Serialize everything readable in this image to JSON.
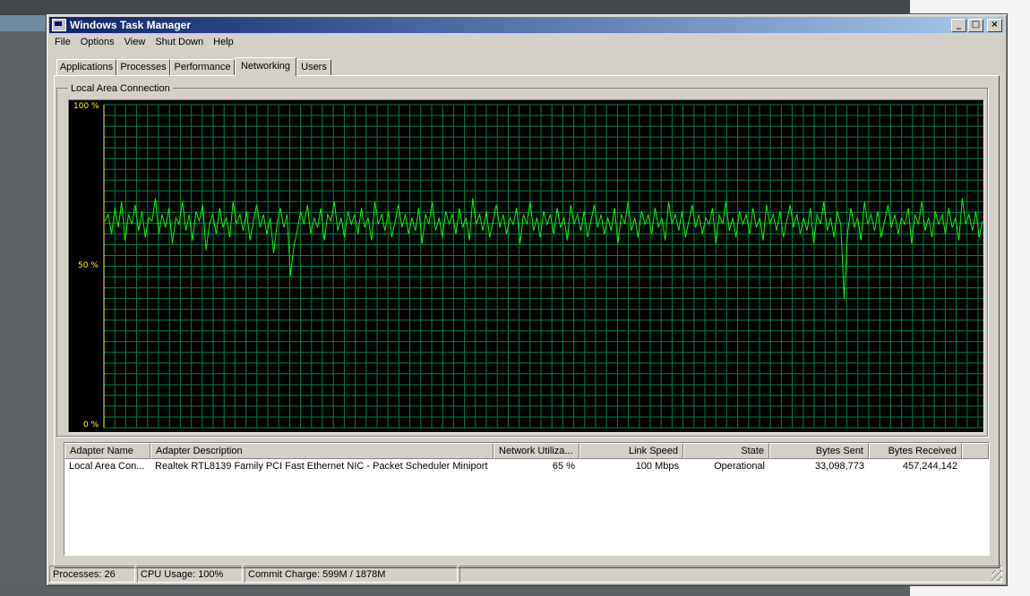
{
  "window": {
    "title": "Windows Task Manager"
  },
  "title_buttons": {
    "minimize": "_",
    "maximize": "□",
    "close": "×"
  },
  "menu": [
    "File",
    "Options",
    "View",
    "Shut Down",
    "Help"
  ],
  "tabs": [
    "Applications",
    "Processes",
    "Performance",
    "Networking",
    "Users"
  ],
  "active_tab": "Networking",
  "group": {
    "label": "Local Area Connection"
  },
  "graph": {
    "y_labels": [
      "100 %",
      "50 %",
      "0 %"
    ],
    "colors": {
      "background": "#000000",
      "grid": "#008040",
      "line": "#00ff00",
      "left_axis": "#ffff00"
    },
    "utilization_trace_percent": [
      64,
      66,
      60,
      68,
      62,
      70,
      58,
      66,
      63,
      69,
      61,
      67,
      59,
      65,
      64,
      71,
      60,
      66,
      62,
      68,
      57,
      65,
      63,
      70,
      61,
      66,
      58,
      67,
      64,
      69,
      55,
      63,
      66,
      60,
      68,
      62,
      65,
      59,
      70,
      63,
      66,
      61,
      67,
      58,
      64,
      69,
      62,
      66,
      60,
      65,
      54,
      63,
      68,
      62,
      66,
      47,
      56,
      61,
      67,
      63,
      69,
      60,
      65,
      62,
      68,
      58,
      66,
      64,
      70,
      61,
      65,
      59,
      67,
      63,
      66,
      60,
      68,
      62,
      65,
      58,
      70,
      63,
      66,
      61,
      67,
      59,
      64,
      69,
      62,
      66,
      60,
      65,
      61,
      68,
      57,
      66,
      63,
      70,
      61,
      65,
      59,
      67,
      63,
      66,
      60,
      68,
      62,
      65,
      58,
      71,
      63,
      66,
      61,
      67,
      59,
      64,
      69,
      62,
      66,
      60,
      65,
      63,
      68,
      57,
      66,
      63,
      70,
      61,
      65,
      59,
      67,
      63,
      66,
      60,
      68,
      62,
      65,
      58,
      69,
      63,
      66,
      61,
      67,
      59,
      64,
      69,
      62,
      66,
      60,
      65,
      61,
      68,
      57,
      66,
      63,
      70,
      61,
      65,
      59,
      67,
      63,
      66,
      60,
      68,
      62,
      65,
      58,
      70,
      63,
      66,
      61,
      67,
      59,
      64,
      69,
      62,
      66,
      60,
      65,
      63,
      68,
      57,
      66,
      63,
      70,
      61,
      65,
      59,
      67,
      63,
      66,
      60,
      68,
      62,
      65,
      58,
      69,
      63,
      66,
      61,
      67,
      59,
      64,
      69,
      62,
      66,
      60,
      65,
      61,
      68,
      57,
      66,
      63,
      70,
      61,
      65,
      59,
      67,
      63,
      40,
      60,
      68,
      62,
      65,
      58,
      70,
      63,
      66,
      61,
      67,
      59,
      64,
      69,
      62,
      66,
      60,
      65,
      63,
      68,
      57,
      66,
      63,
      70,
      61,
      65,
      59,
      67,
      63,
      66,
      60,
      68,
      62,
      65,
      58,
      71,
      63,
      66,
      61,
      67,
      59,
      64
    ]
  },
  "adapters": {
    "columns": [
      "Adapter Name",
      "Adapter Description",
      "Network Utiliza...",
      "Link Speed",
      "State",
      "Bytes Sent",
      "Bytes Received"
    ],
    "rows": [
      [
        "Local Area Con...",
        "Realtek RTL8139 Family PCI Fast Ethernet NIC - Packet Scheduler Miniport",
        "65 %",
        "100 Mbps",
        "Operational",
        "33,098,773",
        "457,244,142"
      ]
    ]
  },
  "status": {
    "processes": "Processes: 26",
    "cpu": "CPU Usage: 100%",
    "commit": "Commit Charge: 599M / 1878M"
  }
}
